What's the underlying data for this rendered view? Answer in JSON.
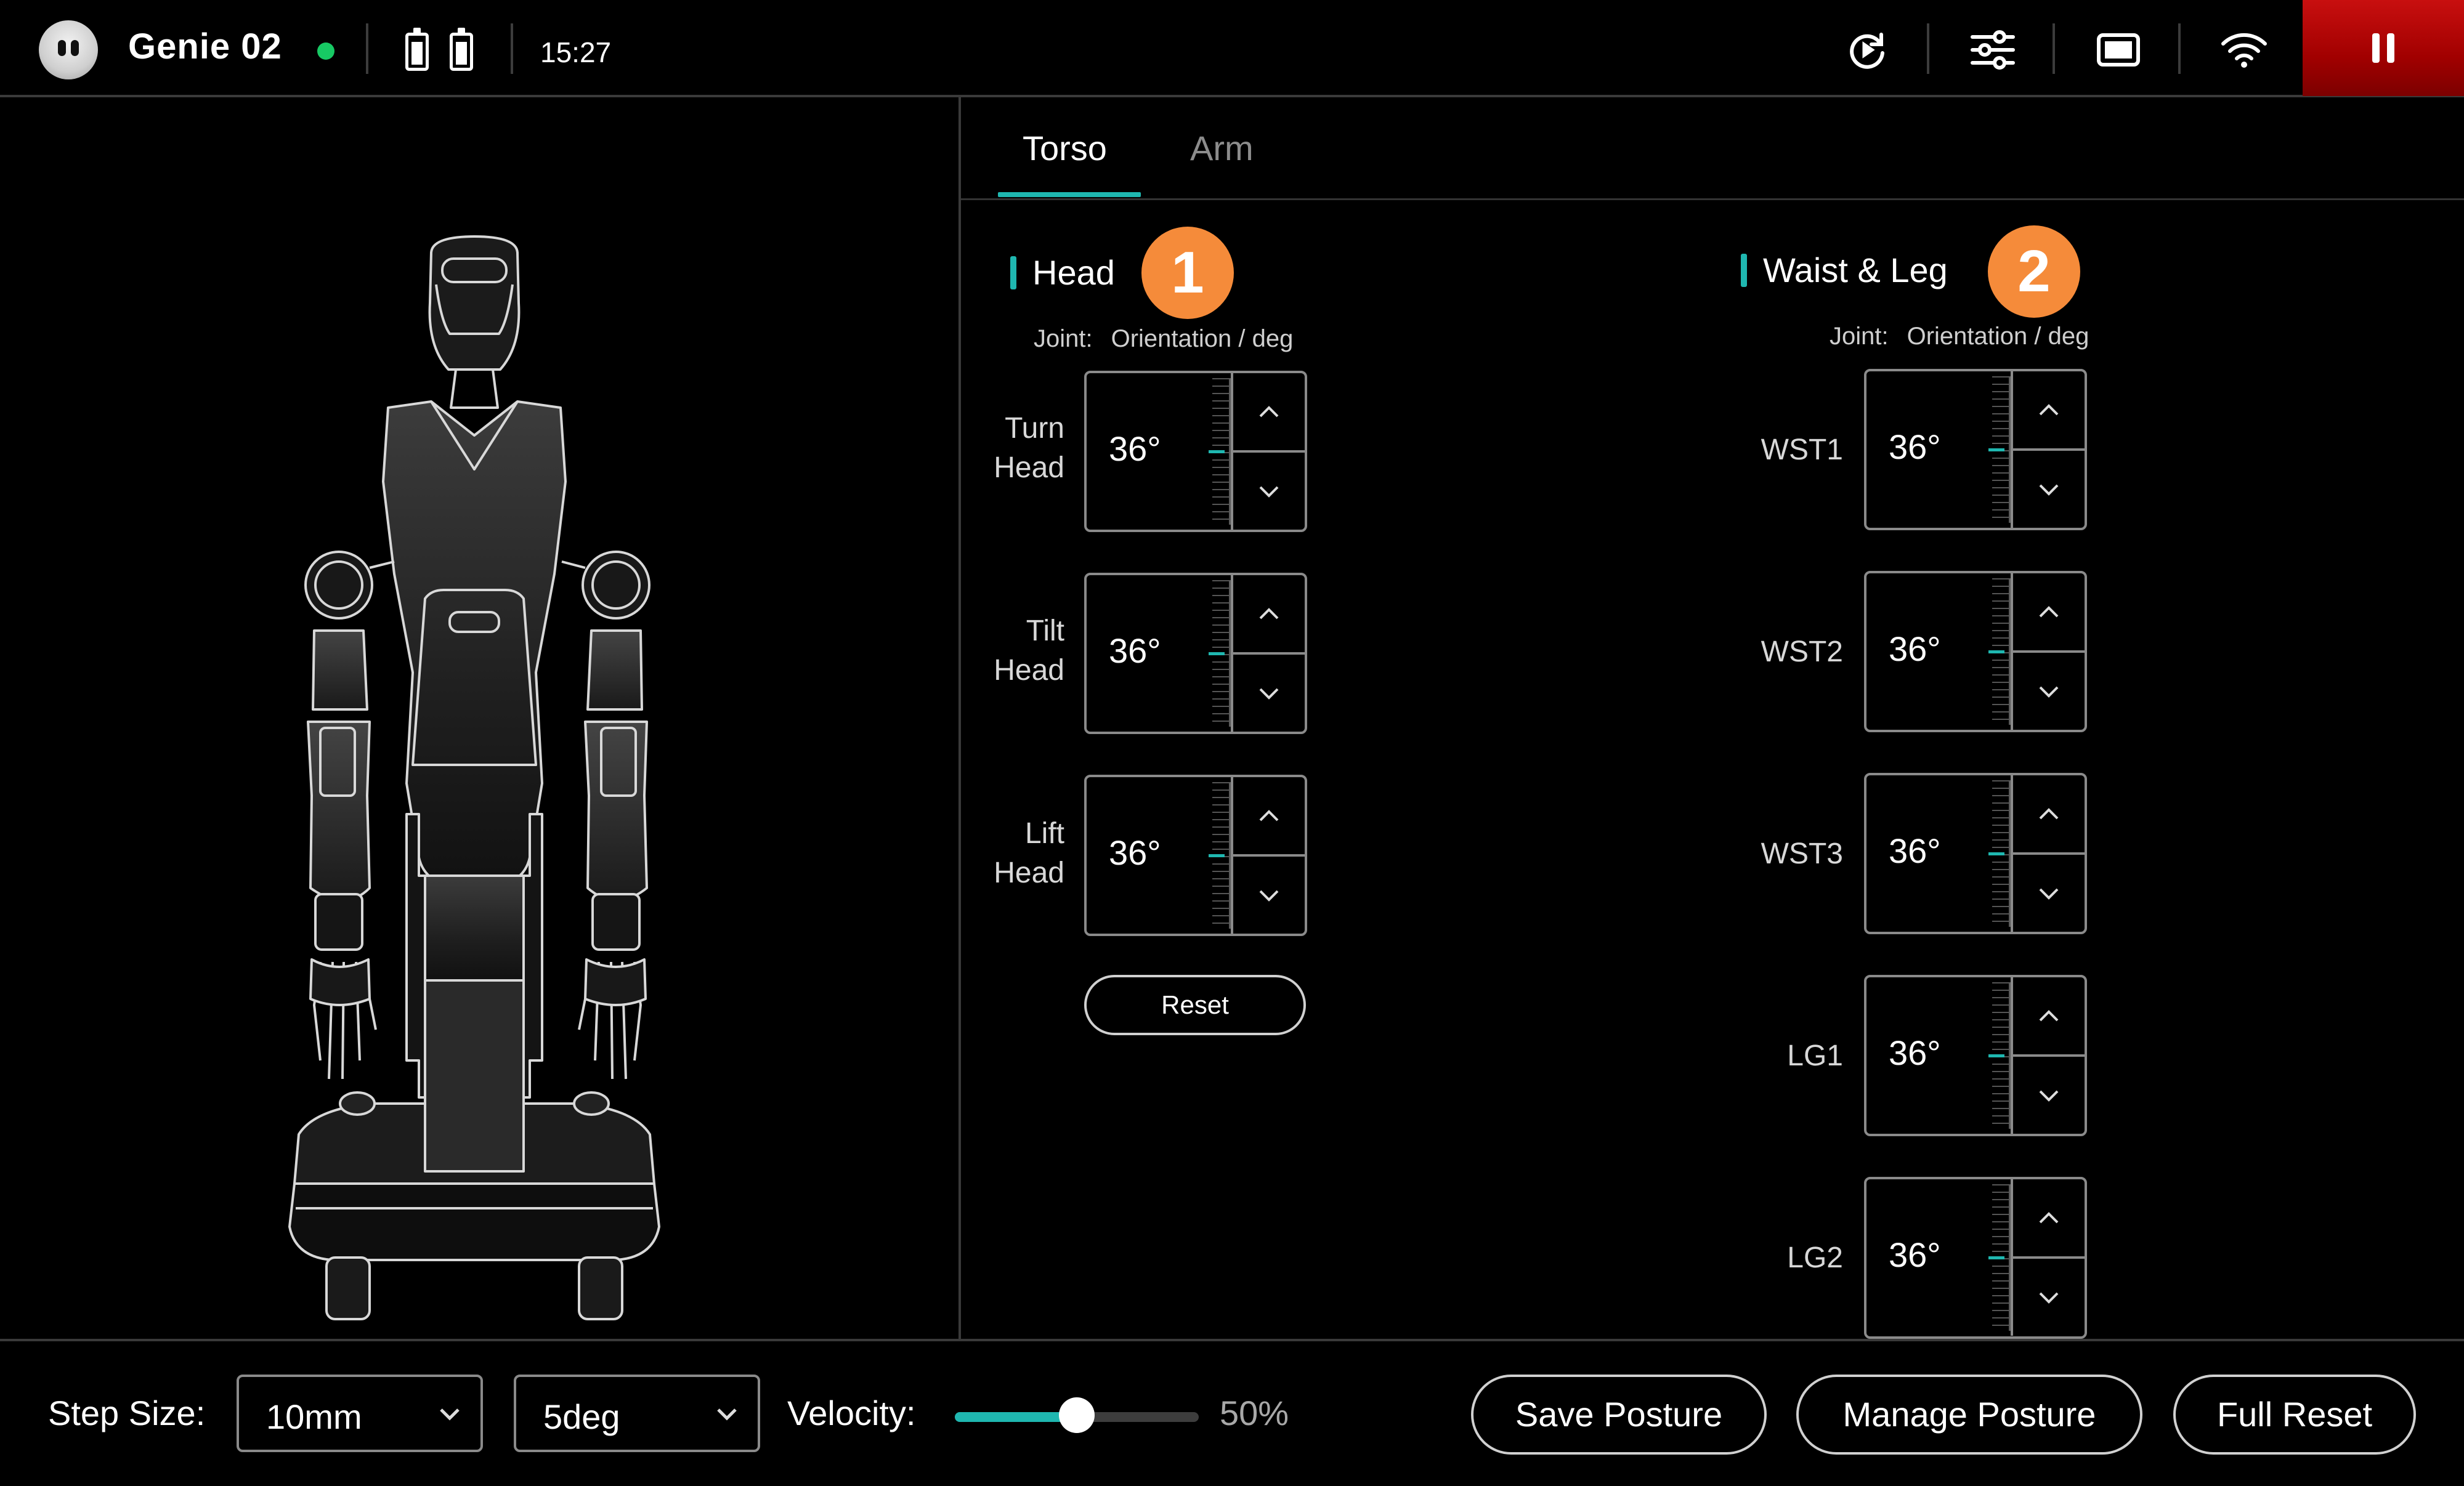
{
  "topbar": {
    "robot_name": "Genie 02",
    "time": "15:27",
    "status_color": "#17c964",
    "icons": [
      "robot-face-icon",
      "battery-icon",
      "battery-icon",
      "replay-icon",
      "sliders-icon",
      "screen-icon",
      "wifi-icon",
      "pause-icon"
    ]
  },
  "tabs": [
    {
      "label": "Torso",
      "active": true
    },
    {
      "label": "Arm",
      "active": false
    }
  ],
  "head": {
    "title": "Head",
    "badge": "1",
    "col_joint": "Joint:",
    "col_value": "Orientation / deg",
    "joints": [
      {
        "line1": "Turn",
        "line2": "Head",
        "value": "36°"
      },
      {
        "line1": "Tilt",
        "line2": "Head",
        "value": "36°"
      },
      {
        "line1": "Lift",
        "line2": "Head",
        "value": "36°"
      }
    ],
    "reset_label": "Reset"
  },
  "waist": {
    "title": "Waist & Leg",
    "badge": "2",
    "col_joint": "Joint:",
    "col_value": "Orientation / deg",
    "joints": [
      {
        "label": "WST1",
        "value": "36°"
      },
      {
        "label": "WST2",
        "value": "36°"
      },
      {
        "label": "WST3",
        "value": "36°"
      },
      {
        "label": "LG1",
        "value": "36°"
      },
      {
        "label": "LG2",
        "value": "36°"
      }
    ]
  },
  "bottombar": {
    "step_size_label": "Step Size:",
    "step_linear": "10mm",
    "step_angular": "5deg",
    "velocity_label": "Velocity:",
    "velocity_value": "50%",
    "velocity_fraction": 0.5,
    "save_posture": "Save Posture",
    "manage_posture": "Manage Posture",
    "full_reset": "Full Reset"
  },
  "colors": {
    "accent": "#1fb7b0",
    "badge": "#f58b3a",
    "pause": "#b00000"
  }
}
